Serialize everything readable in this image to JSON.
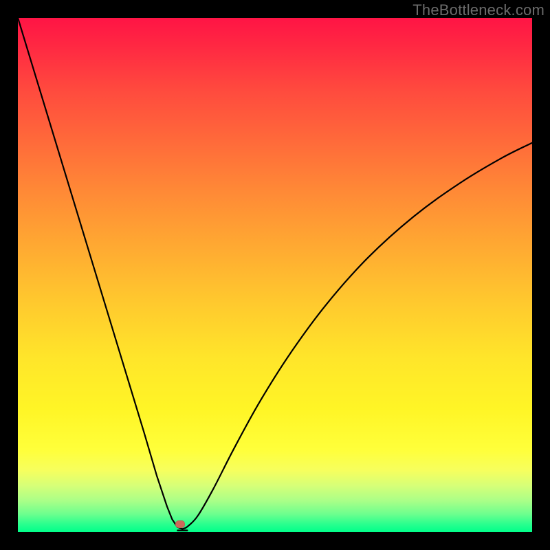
{
  "watermark": "TheBottleneck.com",
  "marker": {
    "x_frac": 0.315,
    "y_frac": 0.985,
    "color": "#cc6a5a"
  },
  "chart_data": {
    "type": "line",
    "title": "",
    "xlabel": "",
    "ylabel": "",
    "xlim": [
      0,
      100
    ],
    "ylim": [
      0,
      100
    ],
    "grid": false,
    "legend": false,
    "annotations": [],
    "series": [
      {
        "name": "bottleneck-curve",
        "x": [
          0,
          3.5,
          7,
          10.5,
          14,
          17.5,
          21,
          24.5,
          27,
          29,
          30,
          31,
          32,
          33,
          35,
          38,
          42,
          47,
          53,
          60,
          68,
          77,
          86,
          94,
          100
        ],
        "values": [
          100,
          88.5,
          77,
          65.5,
          54,
          42.5,
          31,
          19.5,
          11,
          5,
          2.5,
          1,
          0.6,
          1.1,
          3.2,
          8.4,
          16.2,
          25.3,
          34.8,
          44.3,
          53.3,
          61.4,
          67.9,
          72.7,
          75.7
        ]
      }
    ],
    "background_gradient": {
      "top": "#ff1445",
      "mid": "#ffe52a",
      "bottom": "#00ff8a"
    },
    "marker_point": {
      "x": 31.5,
      "y": 1.5
    }
  }
}
